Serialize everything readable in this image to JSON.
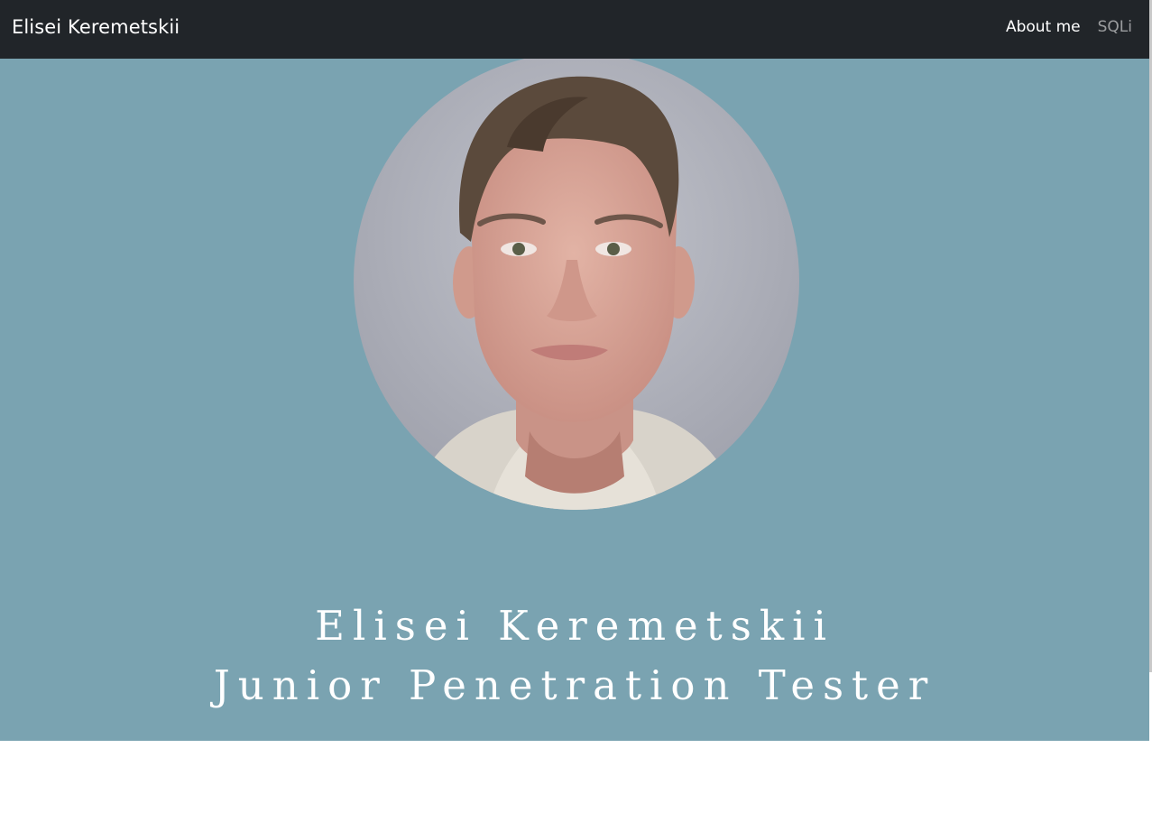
{
  "navbar": {
    "brand": "Elisei Keremetskii",
    "links": [
      {
        "label": "About me",
        "active": true
      },
      {
        "label": "SQLi",
        "active": false
      }
    ]
  },
  "hero": {
    "name": "Elisei Keremetskii",
    "role": "Junior Penetration Tester",
    "background_color": "#7aa3b1"
  },
  "colors": {
    "navbar_bg": "#212529",
    "hero_bg": "#7aa3b1"
  }
}
